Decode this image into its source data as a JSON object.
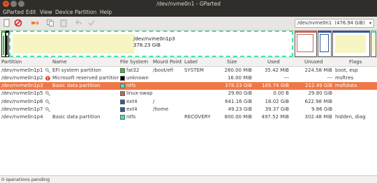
{
  "window": {
    "title": "/dev/nvme0n1 - GParted"
  },
  "menu": [
    "GParted",
    "Edit",
    "View",
    "Device",
    "Partition",
    "Help"
  ],
  "toolbar": {
    "icons": [
      "new-partition-icon",
      "delete-icon",
      "resize-move-icon",
      "copy-icon",
      "paste-icon",
      "undo-icon",
      "apply-icon"
    ],
    "device_selector": {
      "label": "/dev/nvme0n1",
      "size": "(476.94 GiB)"
    }
  },
  "visual": {
    "selected_name": "/dev/nvme0n1p3",
    "selected_size": "378.23 GiB"
  },
  "columns": [
    "Partition",
    "Name",
    "File System",
    "Mount Point",
    "Label",
    "Size",
    "Used",
    "Unused",
    "Flags"
  ],
  "rows": [
    {
      "partition": "/dev/nvme0n1p1",
      "name": "EFI system partition",
      "fs": "fat32",
      "fs_color": "#18d918",
      "mount": "/boot/efi",
      "label": "SYSTEM",
      "size": "260.00 MiB",
      "used": "35.42 MiB",
      "unused": "224.58 MiB",
      "flags": "boot, esp",
      "icon": "key-icon",
      "selected": false
    },
    {
      "partition": "/dev/nvme0n1p2",
      "name": "Microsoft reserved partition",
      "fs": "unknown",
      "fs_color": "#000000",
      "mount": "",
      "label": "",
      "size": "16.00 MiB",
      "used": "---",
      "unused": "---",
      "flags": "msftres",
      "icon": "warning-icon",
      "selected": false
    },
    {
      "partition": "/dev/nvme0n1p3",
      "name": "Basic data partition",
      "fs": "ntfs",
      "fs_color": "#42e5ac",
      "mount": "",
      "label": "",
      "size": "378.23 GiB",
      "used": "165.74 GiB",
      "unused": "212.49 GiB",
      "flags": "msftdata",
      "icon": "",
      "selected": true
    },
    {
      "partition": "/dev/nvme0n1p5",
      "name": "",
      "fs": "linux-swap",
      "fs_color": "#c1665a",
      "mount": "",
      "label": "",
      "size": "29.80 GiB",
      "used": "0.00 B",
      "unused": "29.80 GiB",
      "flags": "",
      "icon": "key-icon",
      "selected": false
    },
    {
      "partition": "/dev/nvme0n1p6",
      "name": "",
      "fs": "ext4",
      "fs_color": "#315895",
      "mount": "/",
      "label": "",
      "size": "641.16 GiB",
      "used": "18.02 GiB",
      "unused": "622.98 MiB",
      "flags": "",
      "icon": "key-icon",
      "selected": false
    },
    {
      "partition": "/dev/nvme0n1p7",
      "name": "",
      "fs": "ext4",
      "fs_color": "#315895",
      "mount": "/home",
      "label": "",
      "size": "49.23 GiB",
      "used": "39.37 GiB",
      "unused": "9.86 GiB",
      "flags": "",
      "icon": "key-icon",
      "selected": false
    },
    {
      "partition": "/dev/nvme0n1p4",
      "name": "Basic data partition",
      "fs": "ntfs",
      "fs_color": "#42e5ac",
      "mount": "",
      "label": "RECOVERY",
      "size": "800.00 MiB",
      "used": "497.52 MiB",
      "unused": "302.48 MiB",
      "flags": "hidden, diag",
      "icon": "",
      "selected": false
    }
  ],
  "status": "0 operations pending"
}
